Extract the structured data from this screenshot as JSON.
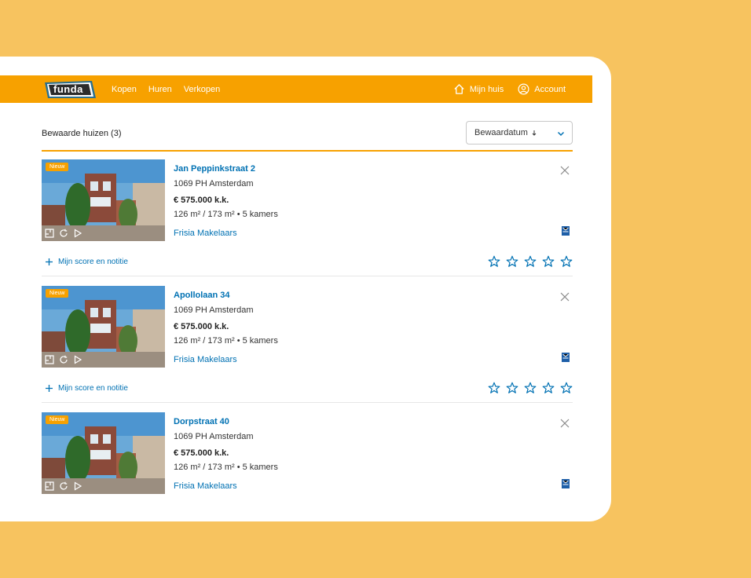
{
  "nav": {
    "logo": "funda",
    "links": [
      "Kopen",
      "Huren",
      "Verkopen"
    ],
    "my_house": "Mijn huis",
    "account": "Account"
  },
  "saved": {
    "title": "Bewaarde huizen (3)",
    "sort_label": "Bewaardatum"
  },
  "listings": [
    {
      "badge": "Nieuw",
      "street": "Jan Peppinkstraat 2",
      "city": "1069 PH Amsterdam",
      "price": "€ 575.000 k.k.",
      "specs": "126 m² / 173 m² • 5 kamers",
      "agent": "Frisia Makelaars",
      "score_label": "Mijn score en notitie"
    },
    {
      "badge": "Nieuw",
      "street": "Apollolaan 34",
      "city": "1069 PH Amsterdam",
      "price": "€ 575.000 k.k.",
      "specs": "126 m² / 173 m² • 5 kamers",
      "agent": "Frisia Makelaars",
      "score_label": "Mijn score en notitie"
    },
    {
      "badge": "Nieuw",
      "street": "Dorpstraat 40",
      "city": "1069 PH Amsterdam",
      "price": "€ 575.000 k.k.",
      "specs": "126 m² / 173 m² • 5 kamers",
      "agent": "Frisia Makelaars"
    }
  ],
  "colors": {
    "brand": "#f7a100",
    "link": "#0071b3",
    "background": "#f7c35f"
  }
}
